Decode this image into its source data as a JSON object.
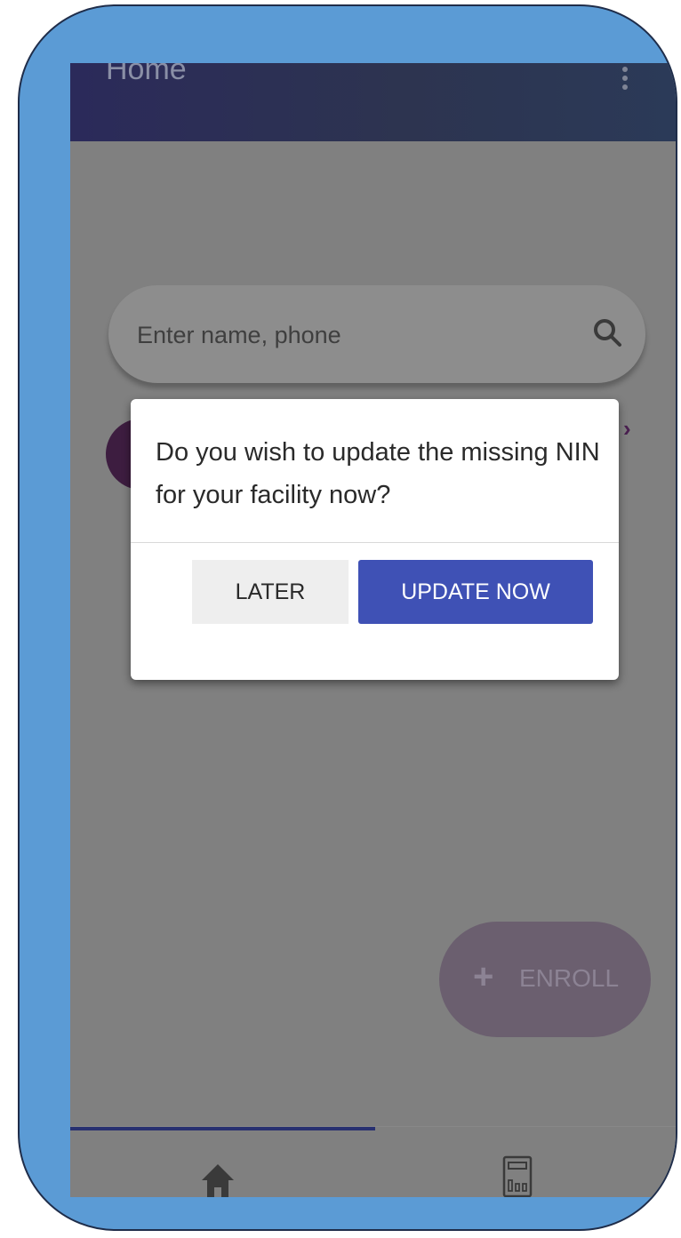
{
  "app_bar": {
    "title": "Home",
    "menu_icon": "more-vert-icon"
  },
  "search": {
    "placeholder": "Enter name, phone",
    "icon": "search-icon"
  },
  "list": {
    "chevron_icon": "chevron-right-icon"
  },
  "dialog": {
    "message": "Do you wish to update the missing NIN for your facility now?",
    "later_label": "LATER",
    "update_label": "UPDATE NOW"
  },
  "fab": {
    "icon": "plus-icon",
    "label": "ENROLL"
  },
  "bottom_nav": {
    "tabs": [
      {
        "icon": "home-icon",
        "selected": true
      },
      {
        "icon": "stats-icon",
        "selected": false
      }
    ]
  },
  "colors": {
    "app_bar": "#2b2a5a",
    "primary_button": "#3f51b5",
    "frame": "#5b9bd5",
    "scrim": "#808080"
  }
}
